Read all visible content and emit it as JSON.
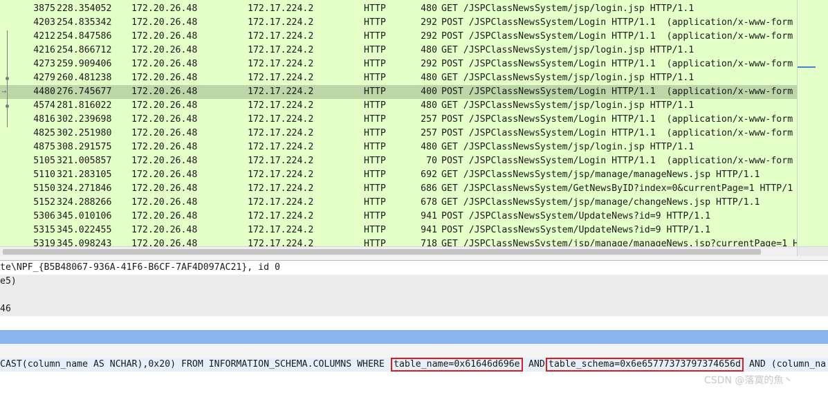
{
  "packets": [
    {
      "no": "3875",
      "time": "228.354052",
      "source": "172.20.26.48",
      "destination": "172.17.224.2",
      "protocol": "HTTP",
      "length": "480",
      "info": "GET /JSPClassNewsSystem/jsp/login.jsp HTTP/1.1"
    },
    {
      "no": "4203",
      "time": "254.835342",
      "source": "172.20.26.48",
      "destination": "172.17.224.2",
      "protocol": "HTTP",
      "length": "292",
      "info": "POST /JSPClassNewsSystem/Login HTTP/1.1  (application/x-www-form"
    },
    {
      "no": "4212",
      "time": "254.847586",
      "source": "172.20.26.48",
      "destination": "172.17.224.2",
      "protocol": "HTTP",
      "length": "292",
      "info": "POST /JSPClassNewsSystem/Login HTTP/1.1  (application/x-www-form"
    },
    {
      "no": "4216",
      "time": "254.866712",
      "source": "172.20.26.48",
      "destination": "172.17.224.2",
      "protocol": "HTTP",
      "length": "480",
      "info": "GET /JSPClassNewsSystem/jsp/login.jsp HTTP/1.1"
    },
    {
      "no": "4273",
      "time": "259.909406",
      "source": "172.20.26.48",
      "destination": "172.17.224.2",
      "protocol": "HTTP",
      "length": "292",
      "info": "POST /JSPClassNewsSystem/Login HTTP/1.1  (application/x-www-form"
    },
    {
      "no": "4279",
      "time": "260.481238",
      "source": "172.20.26.48",
      "destination": "172.17.224.2",
      "protocol": "HTTP",
      "length": "480",
      "info": "GET /JSPClassNewsSystem/jsp/login.jsp HTTP/1.1"
    },
    {
      "no": "4480",
      "time": "276.745677",
      "source": "172.20.26.48",
      "destination": "172.17.224.2",
      "protocol": "HTTP",
      "length": "400",
      "info": "POST /JSPClassNewsSystem/Login HTTP/1.1  (application/x-www-form",
      "selected": true
    },
    {
      "no": "4574",
      "time": "281.816022",
      "source": "172.20.26.48",
      "destination": "172.17.224.2",
      "protocol": "HTTP",
      "length": "480",
      "info": "GET /JSPClassNewsSystem/jsp/login.jsp HTTP/1.1"
    },
    {
      "no": "4816",
      "time": "302.239698",
      "source": "172.20.26.48",
      "destination": "172.17.224.2",
      "protocol": "HTTP",
      "length": "257",
      "info": "POST /JSPClassNewsSystem/Login HTTP/1.1  (application/x-www-form"
    },
    {
      "no": "4825",
      "time": "302.251980",
      "source": "172.20.26.48",
      "destination": "172.17.224.2",
      "protocol": "HTTP",
      "length": "257",
      "info": "POST /JSPClassNewsSystem/Login HTTP/1.1  (application/x-www-form"
    },
    {
      "no": "4875",
      "time": "308.291575",
      "source": "172.20.26.48",
      "destination": "172.17.224.2",
      "protocol": "HTTP",
      "length": "480",
      "info": "GET /JSPClassNewsSystem/jsp/login.jsp HTTP/1.1"
    },
    {
      "no": "5105",
      "time": "321.005857",
      "source": "172.20.26.48",
      "destination": "172.17.224.2",
      "protocol": "HTTP",
      "length": "70",
      "info": "POST /JSPClassNewsSystem/Login HTTP/1.1  (application/x-www-form"
    },
    {
      "no": "5110",
      "time": "321.283105",
      "source": "172.20.26.48",
      "destination": "172.17.224.2",
      "protocol": "HTTP",
      "length": "692",
      "info": "GET /JSPClassNewsSystem/jsp/manage/manageNews.jsp HTTP/1.1"
    },
    {
      "no": "5150",
      "time": "324.271846",
      "source": "172.20.26.48",
      "destination": "172.17.224.2",
      "protocol": "HTTP",
      "length": "686",
      "info": "GET /JSPClassNewsSystem/GetNewsByID?index=0&currentPage=1 HTTP/1"
    },
    {
      "no": "5152",
      "time": "324.288266",
      "source": "172.20.26.48",
      "destination": "172.17.224.2",
      "protocol": "HTTP",
      "length": "678",
      "info": "GET /JSPClassNewsSystem/jsp/manage/changeNews.jsp HTTP/1.1"
    },
    {
      "no": "5306",
      "time": "345.010106",
      "source": "172.20.26.48",
      "destination": "172.17.224.2",
      "protocol": "HTTP",
      "length": "941",
      "info": "POST /JSPClassNewsSystem/UpdateNews?id=9 HTTP/1.1"
    },
    {
      "no": "5315",
      "time": "345.022455",
      "source": "172.20.26.48",
      "destination": "172.17.224.2",
      "protocol": "HTTP",
      "length": "941",
      "info": "POST /JSPClassNewsSystem/UpdateNews?id=9 HTTP/1.1"
    },
    {
      "no": "5319",
      "time": "345.098243",
      "source": "172.20.26.48",
      "destination": "172.17.224.2",
      "protocol": "HTTP",
      "length": "718",
      "info": "GET /JSPClassNewsSystem/jsp/manage/manageNews.jsp?currentPage=1 H"
    }
  ],
  "details": {
    "line1": "te\\NPF_{B5B48067-936A-41F6-B6CF-7AF4D097AC21}, id 0",
    "line2": "e5)",
    "line3": "46",
    "sql_prefix": "CAST(column_name AS NCHAR),0x20) FROM INFORMATION_SCHEMA.COLUMNS WHERE ",
    "sql_highlight_1": "table_name=0x61646d696e",
    "sql_and": " AND ",
    "sql_highlight_2": "table_schema=0x6e65777373797374656d",
    "sql_suffix": " AND (column_na"
  },
  "watermark": "CSDN @落寞的魚丶",
  "colors": {
    "list_bg": "#e4ffc7",
    "selected_row": "#bcd6a8",
    "detail_selected": "#8ab5ec",
    "highlight_box": "#e0191e"
  }
}
